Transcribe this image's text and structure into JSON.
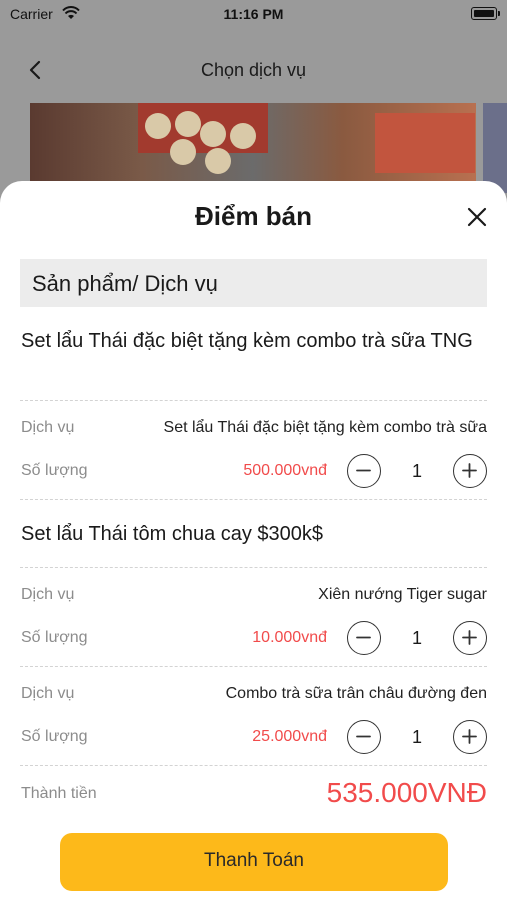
{
  "status_bar": {
    "carrier": "Carrier",
    "time": "11:16 PM"
  },
  "nav": {
    "title": "Chọn dịch vụ"
  },
  "sheet": {
    "title": "Điểm bán",
    "section_header": "Sản phẩm/ Dịch vụ",
    "service_label": "Dịch vụ",
    "quantity_label": "Số lượng",
    "products": [
      {
        "name": "Set lẩu Thái đặc biệt tặng kèm combo trà sữa TNG",
        "items": [
          {
            "service": "Set lẩu Thái đặc biệt tặng kèm combo trà sữa",
            "price": "500.000vnđ",
            "quantity": "1"
          }
        ]
      },
      {
        "name": "Set lẩu Thái tôm chua cay $300k$",
        "items": [
          {
            "service": "Xiên nướng Tiger sugar",
            "price": "10.000vnđ",
            "quantity": "1"
          },
          {
            "service": "Combo trà sữa trân châu đường đen",
            "price": "25.000vnđ",
            "quantity": "1"
          }
        ]
      }
    ],
    "total_label": "Thành tiền",
    "total_value": "535.000VNĐ",
    "pay_button": "Thanh Toán"
  },
  "colors": {
    "accent": "#fdb91a",
    "price": "#f14b4b",
    "section_bg": "#ececec"
  }
}
